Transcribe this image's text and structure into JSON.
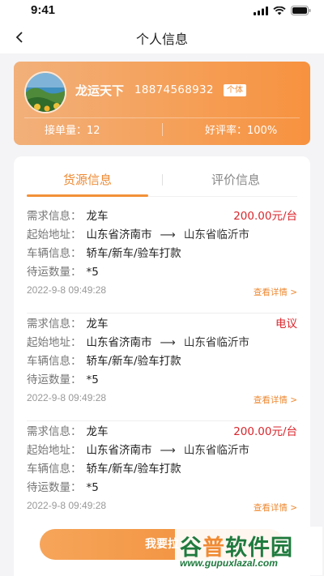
{
  "status_bar": {
    "time": "9:41"
  },
  "nav": {
    "title": "个人信息"
  },
  "profile": {
    "name": "龙运天下",
    "phone": "18874568932",
    "badge": "个体",
    "orders_label": "接单量：",
    "orders_value": "12",
    "rating_label": "好评率：",
    "rating_value": "100%"
  },
  "tabs": [
    {
      "label": "货源信息",
      "active": true
    },
    {
      "label": "评价信息",
      "active": false
    }
  ],
  "field_labels": {
    "demand": "需求信息：",
    "address": "起始地址：",
    "vehicle": "车辆信息：",
    "quantity": "待运数量："
  },
  "items": [
    {
      "demand": "龙车",
      "price": "200.00元/台",
      "from": "山东省济南市",
      "arrow": "⟶",
      "to": "山东省临沂市",
      "vehicle": "轿车/新车/验车打款",
      "quantity": "*5",
      "time": "2022-9-8 09:49:28",
      "link": "查看详情 >"
    },
    {
      "demand": "龙车",
      "price": "电议",
      "from": "山东省济南市",
      "arrow": "⟶",
      "to": "山东省临沂市",
      "vehicle": "轿车/新车/验车打款",
      "quantity": "*5",
      "time": "2022-9-8 09:49:28",
      "link": "查看详情 >"
    },
    {
      "demand": "龙车",
      "price": "200.00元/台",
      "from": "山东省济南市",
      "arrow": "⟶",
      "to": "山东省临沂市",
      "vehicle": "轿车/新车/验车打款",
      "quantity": "*5",
      "time": "2022-9-8 09:49:28",
      "link": "查看详情 >"
    }
  ],
  "bottom_button": {
    "label": "我要拉"
  },
  "watermark": {
    "logo_a": "谷",
    "logo_b": "普",
    "logo_c": "软件园",
    "url": "www.gupuxlazal.com"
  },
  "colors": {
    "accent": "#f08a33",
    "price": "#d9262c",
    "brand_green": "#1f7a3e"
  },
  "icons": [
    "signal-icon",
    "wifi-icon",
    "battery-icon",
    "back-arrow-icon",
    "avatar-landscape-icon"
  ]
}
